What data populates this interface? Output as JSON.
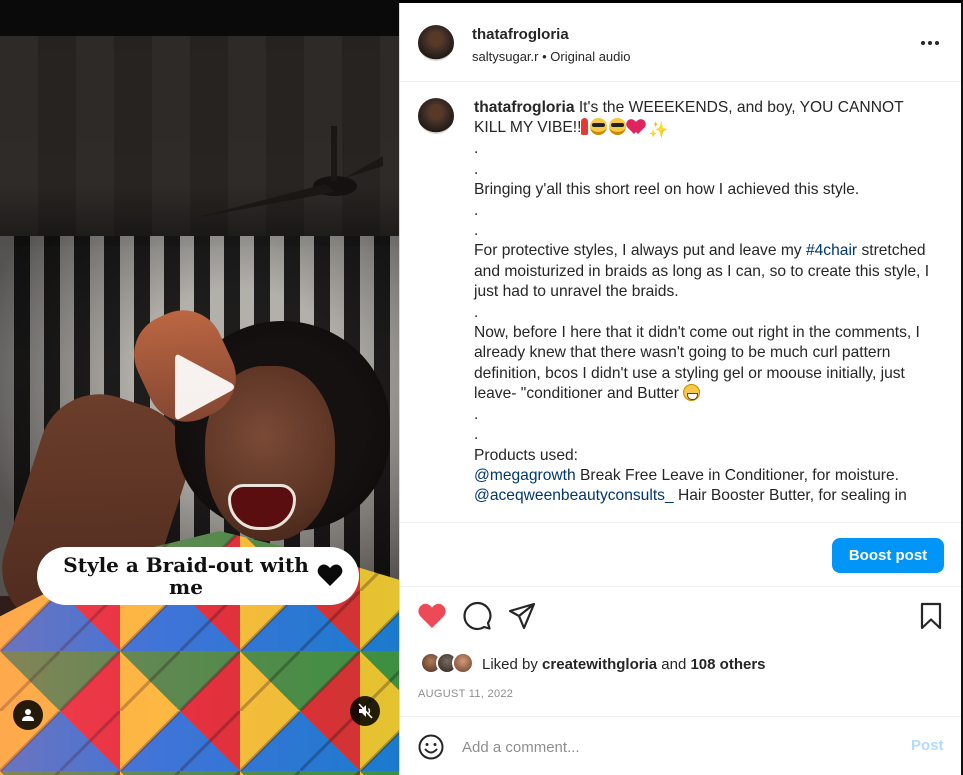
{
  "post": {
    "username": "thatafrogloria",
    "audio_user": "saltysugar.r",
    "audio_label": "Original audio",
    "audio_sep": "•"
  },
  "media": {
    "overlay_caption": "Style a Braid-out with me",
    "icons": {
      "play": "play-icon",
      "heart": "heart-icon",
      "user": "user-icon",
      "mute": "speaker-muted-icon"
    }
  },
  "caption": {
    "username": "thatafrogloria",
    "line1_text": " It's the WEEEKENDS, and boy, YOU CANNOT KILL MY VIBE!!",
    "dot": ".",
    "line_bringing": "Bringing y'all this short reel on how I achieved this style.",
    "protective_pre": "For protective styles, I always put and leave my ",
    "hashtag": "#4chair",
    "protective_post": " stretched and moisturized in braids as long as I can, so to create this style, I just had to unravel the braids.",
    "now_text": "Now, before I here that it didn't come out right in the comments, I already knew that there wasn't going to be much curl pattern definition, bcos I didn't use a styling gel or moouse initially, just leave- \"conditioner and Butter ",
    "products_title": "Products used:",
    "mention1": "@megagrowth",
    "mention1_text": " Break Free Leave in Conditioner, for moisture.",
    "mention2": "@aceqweenbeautyconsults_",
    "mention2_text": " Hair Booster Butter, for sealing in"
  },
  "boost": {
    "label": "Boost post"
  },
  "actions": {
    "liked_by_prefix": "Liked by ",
    "liked_by_user": "createwithgloria",
    "and": " and ",
    "others": "108 others",
    "date": "AUGUST 11, 2022",
    "colors": {
      "like_active": "#ed4956",
      "link": "#00376b",
      "boost": "#0095f6"
    }
  },
  "comment": {
    "placeholder": "Add a comment...",
    "post_label": "Post"
  }
}
